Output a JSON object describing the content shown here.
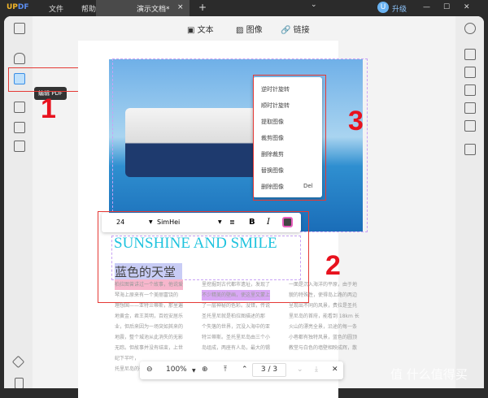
{
  "titlebar": {
    "logo_up": "UP",
    "logo_df": "DF",
    "menu_file": "文件",
    "menu_help": "帮助",
    "tab_title": "演示文档*",
    "tab_close": "×",
    "tab_add": "+",
    "chevron": "⌄",
    "avatar": "U",
    "upgrade": "升级",
    "minimize": "—",
    "maximize": "☐",
    "close": "✕"
  },
  "toolbar": {
    "text": "文本",
    "image": "图像",
    "link": "链接"
  },
  "sidebar": {
    "tooltip": "编辑 PDF"
  },
  "annotations": {
    "n1": "1",
    "n2": "2",
    "n3": "3"
  },
  "context_menu": {
    "items": [
      "逆时针旋转",
      "顺时针旋转",
      "提取图像",
      "裁剪图像",
      "删除裁剪",
      "替换图像",
      "删除图像"
    ],
    "delete_shortcut": "Del"
  },
  "format_toolbar": {
    "font_size": "24",
    "font_name": "SimHei",
    "bold": "B",
    "italic": "I"
  },
  "content": {
    "heading": "SUNSHINE AND SMILE",
    "subheading": "蓝色的天堂",
    "col1": [
      "柏拉图曾讲过一个故事，他说爱",
      "琴海上原来有一个美丽富饶的",
      "理想国——亚特兰蒂斯，那里遍",
      "地黄金，君王英明，百姓安居乐",
      "业，但后来因为一场突如其来的",
      "地震，整个城池从此消失的无影",
      "无踪。但故事并没有结束，上世",
      "纪下半叶，",
      "托里尼岛的调查……"
    ],
    "col2": [
      "里挖掘到古代都市遗址，发现了",
      "不少精美的壁画，使这里又蒙上",
      "了一层神秘的色彩。没错，传说",
      "圣托里尼就是柏拉图描述的那",
      "个失落的世界，沉没入海中的亚",
      "特兰蒂斯。圣托里尼岛由三个小",
      "岛组成，两座有人岛，最大的锡"
    ],
    "col3": [
      "一面是沉入海洋的平原，由于地",
      "貌的特殊性，使得岛上路的两边",
      "呈现出不同的风景，费拉是圣托",
      "里尼岛的首府，能看到 18km 长",
      "火山的漂亮全景，沿途的每一条",
      "小巷都有独特风景，蓝色的圆顶",
      "教堂与白色的墙壁相映成辉，散"
    ]
  },
  "zoom_bar": {
    "zoom": "100%",
    "page": "3 / 3"
  },
  "watermark": "值 什么值得买"
}
